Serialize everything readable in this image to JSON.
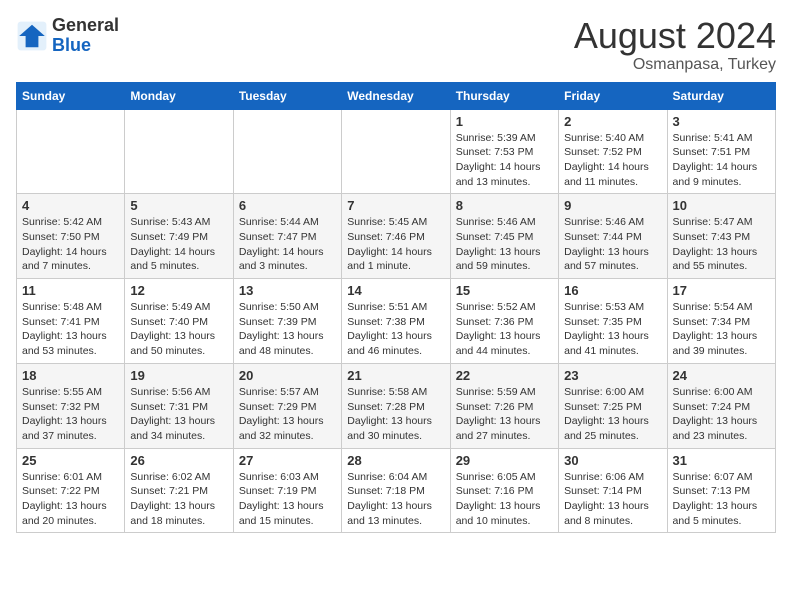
{
  "header": {
    "logo_line1": "General",
    "logo_line2": "Blue",
    "main_title": "August 2024",
    "subtitle": "Osmanpasa, Turkey"
  },
  "calendar": {
    "days_of_week": [
      "Sunday",
      "Monday",
      "Tuesday",
      "Wednesday",
      "Thursday",
      "Friday",
      "Saturday"
    ],
    "weeks": [
      [
        {
          "day": "",
          "info": ""
        },
        {
          "day": "",
          "info": ""
        },
        {
          "day": "",
          "info": ""
        },
        {
          "day": "",
          "info": ""
        },
        {
          "day": "1",
          "info": "Sunrise: 5:39 AM\nSunset: 7:53 PM\nDaylight: 14 hours\nand 13 minutes."
        },
        {
          "day": "2",
          "info": "Sunrise: 5:40 AM\nSunset: 7:52 PM\nDaylight: 14 hours\nand 11 minutes."
        },
        {
          "day": "3",
          "info": "Sunrise: 5:41 AM\nSunset: 7:51 PM\nDaylight: 14 hours\nand 9 minutes."
        }
      ],
      [
        {
          "day": "4",
          "info": "Sunrise: 5:42 AM\nSunset: 7:50 PM\nDaylight: 14 hours\nand 7 minutes."
        },
        {
          "day": "5",
          "info": "Sunrise: 5:43 AM\nSunset: 7:49 PM\nDaylight: 14 hours\nand 5 minutes."
        },
        {
          "day": "6",
          "info": "Sunrise: 5:44 AM\nSunset: 7:47 PM\nDaylight: 14 hours\nand 3 minutes."
        },
        {
          "day": "7",
          "info": "Sunrise: 5:45 AM\nSunset: 7:46 PM\nDaylight: 14 hours\nand 1 minute."
        },
        {
          "day": "8",
          "info": "Sunrise: 5:46 AM\nSunset: 7:45 PM\nDaylight: 13 hours\nand 59 minutes."
        },
        {
          "day": "9",
          "info": "Sunrise: 5:46 AM\nSunset: 7:44 PM\nDaylight: 13 hours\nand 57 minutes."
        },
        {
          "day": "10",
          "info": "Sunrise: 5:47 AM\nSunset: 7:43 PM\nDaylight: 13 hours\nand 55 minutes."
        }
      ],
      [
        {
          "day": "11",
          "info": "Sunrise: 5:48 AM\nSunset: 7:41 PM\nDaylight: 13 hours\nand 53 minutes."
        },
        {
          "day": "12",
          "info": "Sunrise: 5:49 AM\nSunset: 7:40 PM\nDaylight: 13 hours\nand 50 minutes."
        },
        {
          "day": "13",
          "info": "Sunrise: 5:50 AM\nSunset: 7:39 PM\nDaylight: 13 hours\nand 48 minutes."
        },
        {
          "day": "14",
          "info": "Sunrise: 5:51 AM\nSunset: 7:38 PM\nDaylight: 13 hours\nand 46 minutes."
        },
        {
          "day": "15",
          "info": "Sunrise: 5:52 AM\nSunset: 7:36 PM\nDaylight: 13 hours\nand 44 minutes."
        },
        {
          "day": "16",
          "info": "Sunrise: 5:53 AM\nSunset: 7:35 PM\nDaylight: 13 hours\nand 41 minutes."
        },
        {
          "day": "17",
          "info": "Sunrise: 5:54 AM\nSunset: 7:34 PM\nDaylight: 13 hours\nand 39 minutes."
        }
      ],
      [
        {
          "day": "18",
          "info": "Sunrise: 5:55 AM\nSunset: 7:32 PM\nDaylight: 13 hours\nand 37 minutes."
        },
        {
          "day": "19",
          "info": "Sunrise: 5:56 AM\nSunset: 7:31 PM\nDaylight: 13 hours\nand 34 minutes."
        },
        {
          "day": "20",
          "info": "Sunrise: 5:57 AM\nSunset: 7:29 PM\nDaylight: 13 hours\nand 32 minutes."
        },
        {
          "day": "21",
          "info": "Sunrise: 5:58 AM\nSunset: 7:28 PM\nDaylight: 13 hours\nand 30 minutes."
        },
        {
          "day": "22",
          "info": "Sunrise: 5:59 AM\nSunset: 7:26 PM\nDaylight: 13 hours\nand 27 minutes."
        },
        {
          "day": "23",
          "info": "Sunrise: 6:00 AM\nSunset: 7:25 PM\nDaylight: 13 hours\nand 25 minutes."
        },
        {
          "day": "24",
          "info": "Sunrise: 6:00 AM\nSunset: 7:24 PM\nDaylight: 13 hours\nand 23 minutes."
        }
      ],
      [
        {
          "day": "25",
          "info": "Sunrise: 6:01 AM\nSunset: 7:22 PM\nDaylight: 13 hours\nand 20 minutes."
        },
        {
          "day": "26",
          "info": "Sunrise: 6:02 AM\nSunset: 7:21 PM\nDaylight: 13 hours\nand 18 minutes."
        },
        {
          "day": "27",
          "info": "Sunrise: 6:03 AM\nSunset: 7:19 PM\nDaylight: 13 hours\nand 15 minutes."
        },
        {
          "day": "28",
          "info": "Sunrise: 6:04 AM\nSunset: 7:18 PM\nDaylight: 13 hours\nand 13 minutes."
        },
        {
          "day": "29",
          "info": "Sunrise: 6:05 AM\nSunset: 7:16 PM\nDaylight: 13 hours\nand 10 minutes."
        },
        {
          "day": "30",
          "info": "Sunrise: 6:06 AM\nSunset: 7:14 PM\nDaylight: 13 hours\nand 8 minutes."
        },
        {
          "day": "31",
          "info": "Sunrise: 6:07 AM\nSunset: 7:13 PM\nDaylight: 13 hours\nand 5 minutes."
        }
      ]
    ]
  }
}
